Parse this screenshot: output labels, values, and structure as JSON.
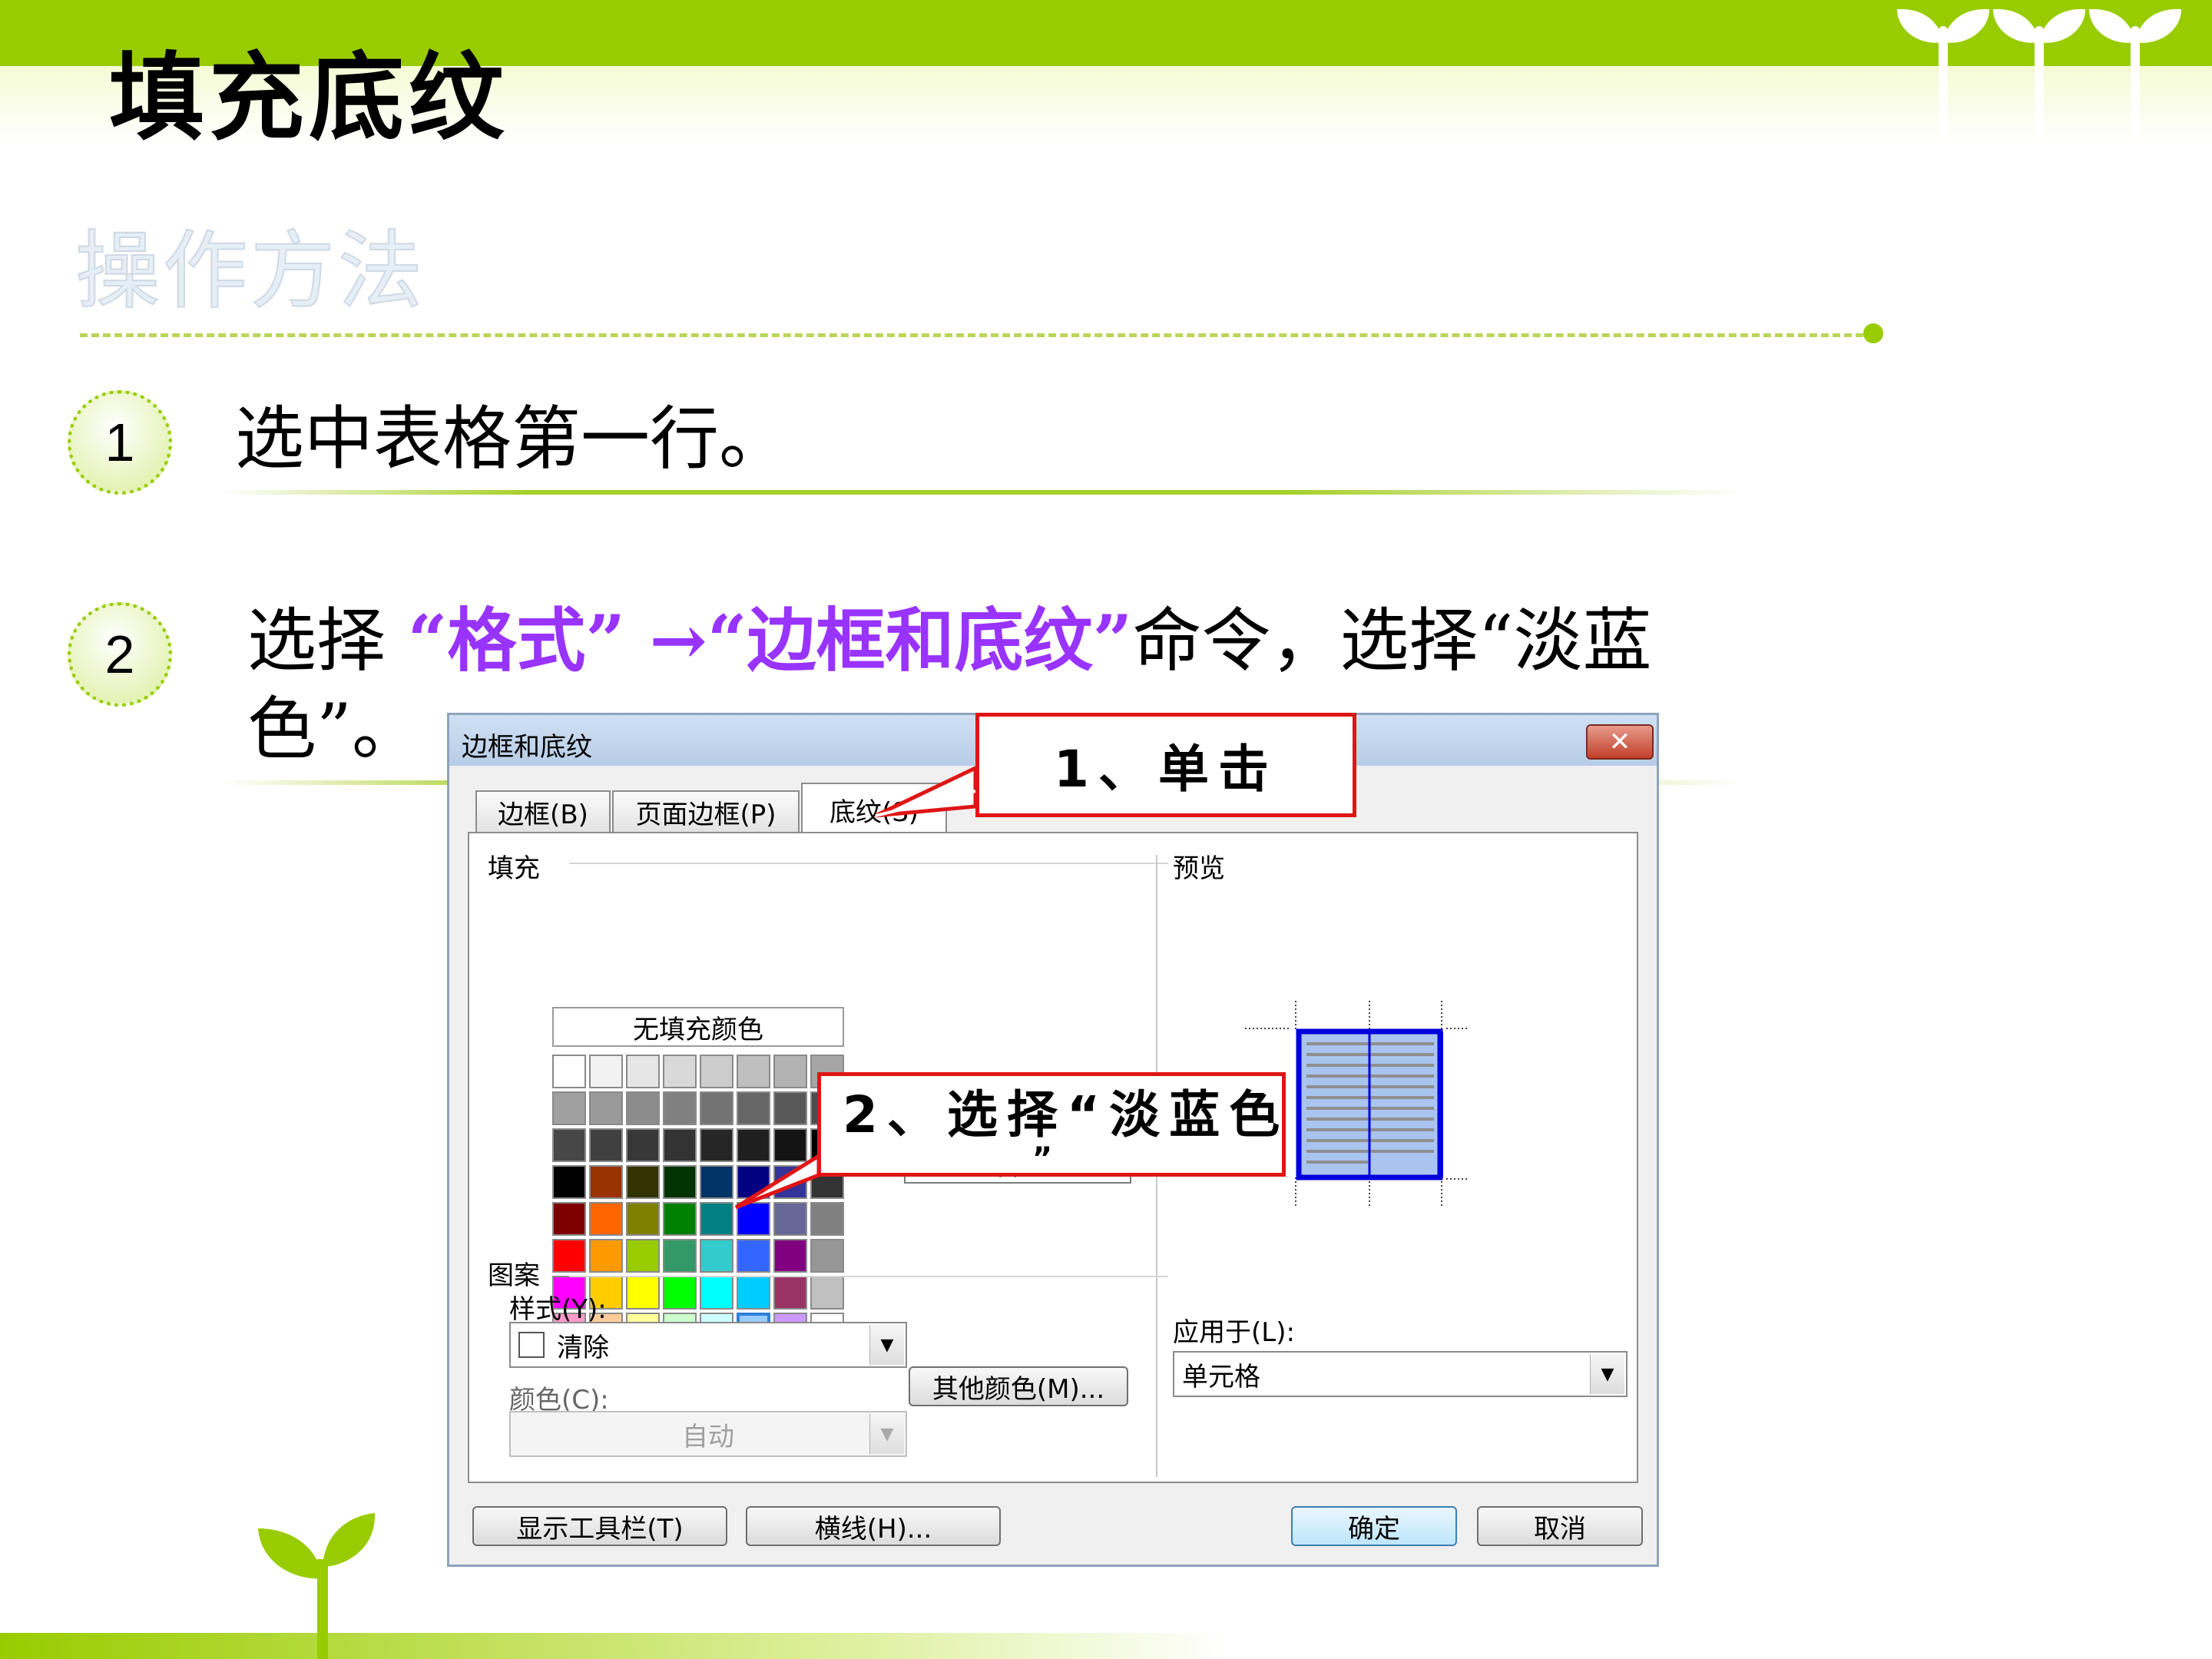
{
  "slide": {
    "title": "填充底纹",
    "subtitle": "操作方法",
    "steps": [
      {
        "number": "1",
        "text": "选中表格第一行。"
      },
      {
        "number": "2",
        "text_before": "选择 ",
        "highlight": "“格式” →“边框和底纹”",
        "text_after": "命令，选择“淡蓝",
        "text_line2": "色”。"
      }
    ]
  },
  "dialog": {
    "title": "边框和底纹",
    "close_glyph": "✕",
    "tabs": [
      {
        "label": "边框(B)",
        "active": false
      },
      {
        "label": "页面边框(P)",
        "active": false
      },
      {
        "label": "底纹(S)",
        "active": true
      }
    ],
    "fill": {
      "label": "填充",
      "no_fill_label": "无填充颜色",
      "selected_color_name": "淡蓝",
      "more_colors_label": "其他颜色(M)...",
      "swatches": [
        "#ffffff",
        "#f2f2f2",
        "#e6e6e6",
        "#d9d9d9",
        "#cccccc",
        "#bfbfbf",
        "#b3b3b3",
        "#a6a6a6",
        "#a0a0a0",
        "#999999",
        "#8c8c8c",
        "#808080",
        "#737373",
        "#666666",
        "#595959",
        "#4d4d4d",
        "#474747",
        "#404040",
        "#383838",
        "#333333",
        "#262626",
        "#1f1f1f",
        "#141414",
        "#000000",
        "#000000",
        "#993300",
        "#333300",
        "#003300",
        "#003366",
        "#000080",
        "#333399",
        "#333333",
        "#800000",
        "#ff6600",
        "#808000",
        "#008000",
        "#008080",
        "#0000ff",
        "#666699",
        "#808080",
        "#ff0000",
        "#ff9900",
        "#99cc00",
        "#339966",
        "#33cccc",
        "#3366ff",
        "#800080",
        "#969696",
        "#ff00ff",
        "#ffcc00",
        "#ffff00",
        "#00ff00",
        "#00ffff",
        "#00ccff",
        "#993366",
        "#c0c0c0",
        "#ff99cc",
        "#ffcc99",
        "#ffff99",
        "#ccffcc",
        "#ccffff",
        "#99ccff",
        "#cc99ff",
        "#ffffff"
      ],
      "selected_swatch_index": 61
    },
    "pattern": {
      "label": "图案",
      "style_label": "样式(Y):",
      "style_value": "清除",
      "color_label": "颜色(C):",
      "color_value": "自动"
    },
    "preview": {
      "label": "预览",
      "apply_label": "应用于(L):",
      "apply_value": "单元格"
    },
    "buttons": {
      "toolbar": "显示工具栏(T)",
      "horizontal_line": "横线(H)...",
      "ok": "确定",
      "cancel": "取消"
    }
  },
  "callouts": {
    "first": "1、单击",
    "second_line1": "2、选择“淡蓝色",
    "second_line2": "”"
  },
  "colors": {
    "brand_green": "#99cc00",
    "highlight_purple": "#9933ff",
    "callout_red": "#e01515",
    "preview_blue": "#0000dd"
  }
}
